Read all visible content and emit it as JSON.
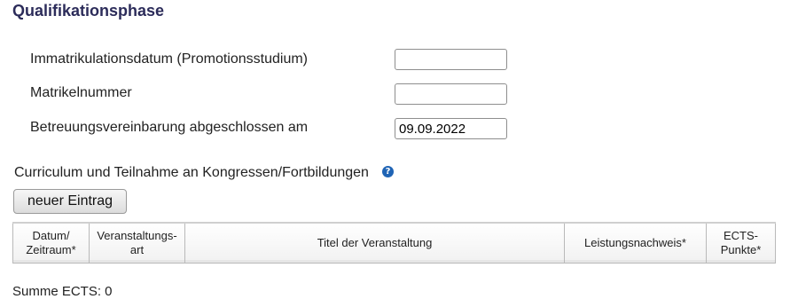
{
  "section": {
    "title": "Qualifikationsphase"
  },
  "form": {
    "matriculation_date": {
      "label": "Immatrikulationsdatum (Promotionsstudium)",
      "value": ""
    },
    "matriculation_number": {
      "label": "Matrikelnummer",
      "value": ""
    },
    "supervision_agreement": {
      "label": "Betreuungsvereinbarung abgeschlossen am",
      "value": "09.09.2022"
    }
  },
  "curriculum": {
    "label": "Curriculum und Teilnahme an Kongressen/Fortbildungen",
    "help_icon": "question-icon",
    "help_glyph": "?",
    "new_entry_label": "neuer Eintrag",
    "columns": [
      "Datum/ Zeitraum*",
      "Veranstaltungs- art",
      "Titel der Veranstaltung",
      "Leistungsnachweis*",
      "ECTS- Punkte*"
    ],
    "rows": []
  },
  "summary": {
    "ects_label": "Summe ECTS: 0"
  },
  "colors": {
    "title": "#2c2c5a",
    "help_icon": "#1f64b5"
  }
}
